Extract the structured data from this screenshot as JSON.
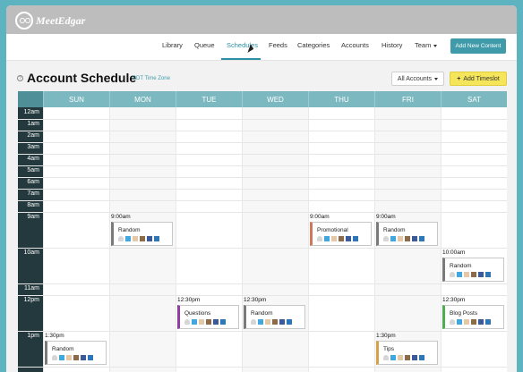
{
  "app": {
    "name": "MeetEdgar"
  },
  "nav": {
    "items": [
      "Library",
      "Queue",
      "Schedules",
      "Feeds",
      "Categories",
      "Accounts",
      "History",
      "Team"
    ],
    "active": "Schedules",
    "add_new_label": "Add New Content"
  },
  "page": {
    "title": "Account Schedule",
    "timezone": "PDT Time Zone",
    "accounts_button": "All Accounts",
    "add_timeslot_button": "Add Timeslot"
  },
  "calendar": {
    "days": [
      "SUN",
      "MON",
      "TUE",
      "WED",
      "THU",
      "FRI",
      "SAT"
    ],
    "hours": [
      "12am",
      "1am",
      "2am",
      "3am",
      "4am",
      "5am",
      "6am",
      "7am",
      "8am",
      "9am",
      "10am",
      "11am",
      "12pm",
      "1pm"
    ],
    "events": [
      {
        "day": "MON",
        "time": "9:00am",
        "label": "Random",
        "color": "#7a7a7a"
      },
      {
        "day": "THU",
        "time": "9:00am",
        "label": "Promotional",
        "color": "#d0785a"
      },
      {
        "day": "FRI",
        "time": "9:00am",
        "label": "Random",
        "color": "#7a7a7a"
      },
      {
        "day": "SAT",
        "time": "10:00am",
        "label": "Random",
        "color": "#7a7a7a"
      },
      {
        "day": "TUE",
        "time": "12:30pm",
        "label": "Questions",
        "color": "#8e3fa0"
      },
      {
        "day": "WED",
        "time": "12:30pm",
        "label": "Random",
        "color": "#7a7a7a"
      },
      {
        "day": "SAT",
        "time": "12:30pm",
        "label": "Blog Posts",
        "color": "#4cae4c"
      },
      {
        "day": "SUN",
        "time": "1:30pm",
        "label": "Random",
        "color": "#7a7a7a"
      },
      {
        "day": "FRI",
        "time": "1:30pm",
        "label": "Tips",
        "color": "#d4a24a"
      }
    ]
  },
  "colors": {
    "accent": "#3f9ba9",
    "header": "#7cb8bf",
    "time_column": "#24393e",
    "timeslot_button": "#f5e55b"
  }
}
